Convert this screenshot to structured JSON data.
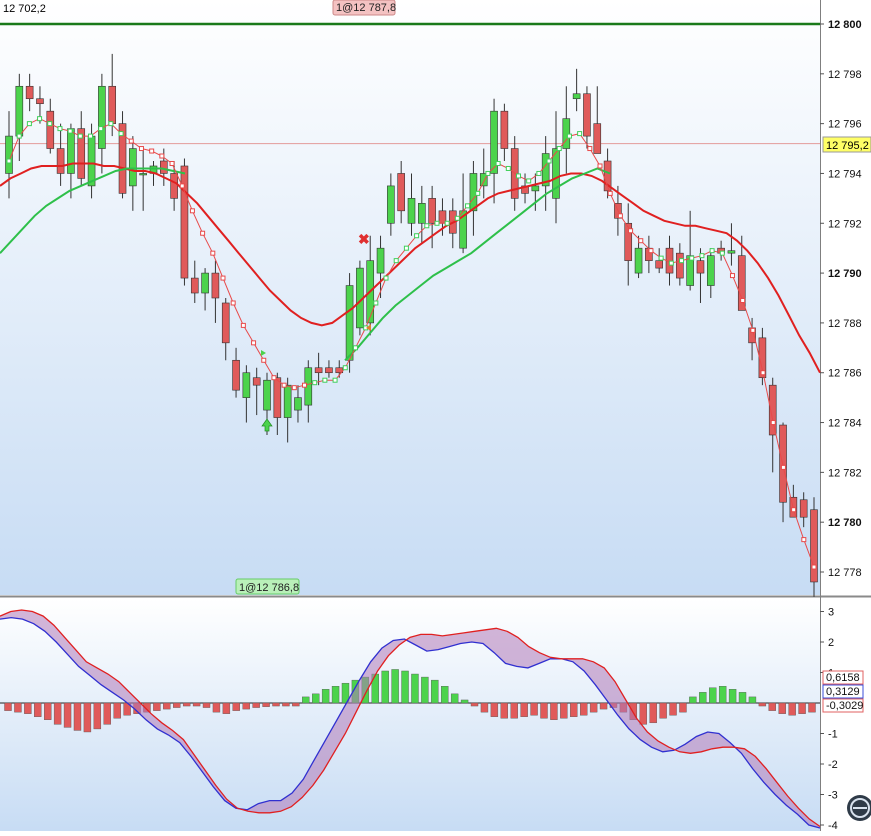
{
  "header": {
    "top_left_value": "12 702,2"
  },
  "order_labels": {
    "sell_order": "1@12 787,8",
    "buy_order": "1@12 786,8"
  },
  "price_panel": {
    "axis_ticks": [
      "12 800",
      "12 798",
      "12 796",
      "12 794",
      "12 792",
      "12 790",
      "12 788",
      "12 786",
      "12 784",
      "12 782",
      "12 780",
      "12 778"
    ],
    "axis_tick_values": [
      12800,
      12798,
      12796,
      12794,
      12792,
      12790,
      12788,
      12786,
      12784,
      12782,
      12780,
      12778
    ],
    "current_price_label": "12 795,2",
    "current_price": 12795.2,
    "resistance_level": 12800
  },
  "oscillator_panel": {
    "axis_ticks": [
      "3",
      "2",
      "1",
      "-1",
      "-2",
      "-3",
      "-4"
    ],
    "axis_tick_values": [
      3,
      2,
      1,
      -1,
      -2,
      -3,
      -4
    ],
    "value_labels": [
      {
        "text": "0,6158",
        "value": 0.6158,
        "color": "#e06060"
      },
      {
        "text": "0,3129",
        "value": 0.3129,
        "color": "#3b4fd8"
      },
      {
        "text": "-0,3029",
        "value": -0.3029,
        "color": "#e06060"
      }
    ]
  },
  "colors": {
    "up_candle": "#4cd34c",
    "down_candle": "#e05a5a",
    "slow_ma": "#e02020",
    "green_ma": "#2ec04a",
    "fast_ma_red": "#e84a4a",
    "fast_ma_green": "#3fcf5a",
    "osc_red": "#e02020",
    "osc_blue": "#3030d0",
    "hist_pos": "#4cd34c",
    "hist_neg": "#e05a5a"
  },
  "chart_data": {
    "type": "candlestick",
    "price_range": [
      12777,
      12801
    ],
    "oscillator_range": [
      -4.1,
      3.2
    ],
    "candles": [
      [
        12794.0,
        12796.5,
        12793.0,
        12795.5
      ],
      [
        12795.5,
        12798.0,
        12794.5,
        12797.5
      ],
      [
        12797.5,
        12798.0,
        12796.5,
        12797.0
      ],
      [
        12797.0,
        12797.5,
        12796.0,
        12796.8
      ],
      [
        12796.5,
        12797.0,
        12794.8,
        12795.0
      ],
      [
        12795.0,
        12796.0,
        12793.5,
        12794.0
      ],
      [
        12794.0,
        12796.0,
        12793.0,
        12795.8
      ],
      [
        12795.8,
        12796.5,
        12793.5,
        12793.8
      ],
      [
        12793.5,
        12796.0,
        12793.0,
        12795.5
      ],
      [
        12795.0,
        12798.0,
        12794.0,
        12797.5
      ],
      [
        12797.5,
        12798.8,
        12795.5,
        12796.0
      ],
      [
        12796.0,
        12796.5,
        12793.0,
        12793.2
      ],
      [
        12793.5,
        12795.5,
        12792.5,
        12795.0
      ],
      [
        12794.0,
        12795.0,
        12792.5,
        12794.0
      ],
      [
        12794.0,
        12794.5,
        12793.5,
        12794.3
      ],
      [
        12794.5,
        12795.0,
        12793.5,
        12794.0
      ],
      [
        12794.0,
        12794.5,
        12792.5,
        12793.0
      ],
      [
        12794.3,
        12794.6,
        12789.5,
        12789.8
      ],
      [
        12789.8,
        12790.5,
        12788.8,
        12789.2
      ],
      [
        12789.2,
        12790.2,
        12788.5,
        12790.0
      ],
      [
        12790.0,
        12790.5,
        12788.0,
        12789.0
      ],
      [
        12788.8,
        12789.0,
        12786.5,
        12787.2
      ],
      [
        12786.5,
        12787.0,
        12785.0,
        12785.3
      ],
      [
        12785.0,
        12786.3,
        12784.0,
        12786.0
      ],
      [
        12785.8,
        12786.2,
        12784.3,
        12785.5
      ],
      [
        12784.5,
        12786.0,
        12783.5,
        12785.7
      ],
      [
        12785.8,
        12786.0,
        12783.5,
        12784.2
      ],
      [
        12784.2,
        12785.8,
        12783.2,
        12785.5
      ],
      [
        12784.5,
        12785.5,
        12784.0,
        12785.0
      ],
      [
        12784.7,
        12786.5,
        12784.0,
        12786.2
      ],
      [
        12786.2,
        12786.8,
        12785.5,
        12786.0
      ],
      [
        12786.2,
        12786.5,
        12785.8,
        12786.0
      ],
      [
        12786.2,
        12786.5,
        12785.8,
        12786.0
      ],
      [
        12786.5,
        12790.0,
        12786.0,
        12789.5
      ],
      [
        12787.8,
        12790.5,
        12787.5,
        12790.2
      ],
      [
        12788.0,
        12791.5,
        12787.5,
        12790.5
      ],
      [
        12790.0,
        12791.5,
        12789.0,
        12791.0
      ],
      [
        12792.0,
        12794.0,
        12791.5,
        12793.5
      ],
      [
        12794.0,
        12794.5,
        12792.0,
        12792.5
      ],
      [
        12792.0,
        12794.0,
        12791.5,
        12793.0
      ],
      [
        12792.0,
        12793.5,
        12791.2,
        12792.8
      ],
      [
        12793.0,
        12793.5,
        12791.0,
        12792.0
      ],
      [
        12792.5,
        12793.0,
        12791.5,
        12792.0
      ],
      [
        12792.5,
        12793.0,
        12791.0,
        12791.6
      ],
      [
        12791.0,
        12794.0,
        12790.8,
        12792.5
      ],
      [
        12792.5,
        12794.5,
        12791.5,
        12794.0
      ],
      [
        12793.5,
        12795.0,
        12793.0,
        12794.0
      ],
      [
        12794.0,
        12797.0,
        12792.8,
        12796.5
      ],
      [
        12796.5,
        12796.8,
        12794.5,
        12795.0
      ],
      [
        12795.0,
        12795.5,
        12792.5,
        12793.0
      ],
      [
        12793.5,
        12794.0,
        12792.8,
        12793.2
      ],
      [
        12793.3,
        12794.0,
        12792.5,
        12793.5
      ],
      [
        12793.5,
        12795.5,
        12792.5,
        12794.8
      ],
      [
        12793.0,
        12796.5,
        12792.0,
        12795.0
      ],
      [
        12795.0,
        12797.5,
        12794.0,
        12796.2
      ],
      [
        12797.0,
        12798.2,
        12796.5,
        12797.2
      ],
      [
        12797.2,
        12797.5,
        12795.0,
        12795.5
      ],
      [
        12796.0,
        12797.5,
        12795.0,
        12794.8
      ],
      [
        12794.5,
        12795.0,
        12793.0,
        12793.3
      ],
      [
        12792.8,
        12793.5,
        12791.5,
        12792.2
      ],
      [
        12792.0,
        12792.8,
        12789.5,
        12790.5
      ],
      [
        12790.0,
        12791.5,
        12789.8,
        12791.0
      ],
      [
        12791.0,
        12791.5,
        12790.0,
        12790.5
      ],
      [
        12790.5,
        12791.0,
        12790.0,
        12790.2
      ],
      [
        12791.0,
        12791.5,
        12789.5,
        12790.0
      ],
      [
        12790.8,
        12791.2,
        12789.5,
        12789.8
      ],
      [
        12789.5,
        12792.5,
        12789.3,
        12790.7
      ],
      [
        12790.5,
        12791.0,
        12788.8,
        12790.0
      ],
      [
        12789.5,
        12791.0,
        12789.0,
        12790.7
      ],
      [
        12791.0,
        12791.3,
        12790.5,
        12790.8
      ],
      [
        12790.8,
        12792.0,
        12790.3,
        12790.9
      ],
      [
        12790.7,
        12791.5,
        12790.5,
        12788.5
      ],
      [
        12787.8,
        12788.2,
        12786.5,
        12787.2
      ],
      [
        12787.4,
        12787.8,
        12785.5,
        12785.8
      ],
      [
        12785.5,
        12785.8,
        12782.0,
        12783.5
      ],
      [
        12783.9,
        12784.0,
        12780.0,
        12780.8
      ],
      [
        12781.0,
        12781.5,
        12780.2,
        12780.2
      ],
      [
        12780.9,
        12781.2,
        12779.8,
        12780.2
      ],
      [
        12780.5,
        12781.0,
        12777.0,
        12777.6
      ]
    ],
    "slow_ma": [
      12793.5,
      12793.8,
      12794.0,
      12794.2,
      12794.3,
      12794.3,
      12794.3,
      12794.4,
      12794.4,
      12794.4,
      12794.3,
      12794.3,
      12794.2,
      12794.1,
      12794.1,
      12794.0,
      12793.8,
      12793.6,
      12793.2,
      12792.8,
      12792.3,
      12791.8,
      12791.3,
      12790.8,
      12790.3,
      12789.8,
      12789.3,
      12788.9,
      12788.5,
      12788.2,
      12788.0,
      12787.9,
      12788.0,
      12788.3,
      12788.6,
      12789.0,
      12789.4,
      12789.8,
      12790.2,
      12790.6,
      12791.0,
      12791.3,
      12791.6,
      12791.9,
      12792.1,
      12792.4,
      12792.7,
      12793.0,
      12793.2,
      12793.3,
      12793.4,
      12793.5,
      12793.6,
      12793.7,
      12793.9,
      12794.0,
      12794.0,
      12793.9,
      12793.7,
      12793.4,
      12793.1,
      12792.8,
      12792.5,
      12792.3,
      12792.1,
      12792.0,
      12791.9,
      12791.9,
      12791.8,
      12791.7,
      12791.6,
      12791.3,
      12790.9,
      12790.4,
      12789.8,
      12789.1,
      12788.3,
      12787.5,
      12786.8,
      12786.0
    ],
    "green_ma": [
      12790.8,
      12791.3,
      12791.8,
      12792.3,
      12792.7,
      12793.0,
      12793.3,
      12793.5,
      12793.7,
      12793.9,
      12794.1,
      12794.2,
      12794.2,
      12794.2,
      12794.2,
      12794.1,
      12794.0
    ],
    "green_ma_right": [
      12786.5,
      12787.0,
      12787.6,
      12788.2,
      12788.7,
      12789.1,
      12789.5,
      12789.9,
      12790.2,
      12790.5,
      12790.8,
      12791.2,
      12791.6,
      12792.0,
      12792.4,
      12792.8,
      12793.2,
      12793.5,
      12793.8,
      12794.0,
      12794.2,
      12794.0
    ],
    "fast_ma": [
      12794.5,
      12795.5,
      12796.0,
      12796.2,
      12796.0,
      12795.8,
      12795.7,
      12795.5,
      12795.5,
      12795.8,
      12796.0,
      12795.6,
      12795.3,
      12795.0,
      12794.9,
      12794.7,
      12794.4,
      12793.5,
      12792.5,
      12791.6,
      12790.8,
      12789.8,
      12788.8,
      12787.9,
      12787.2,
      12786.5,
      12785.8,
      12785.5,
      12785.4,
      12785.5,
      12785.6,
      12785.7,
      12785.7,
      12786.2,
      12787.0,
      12787.8,
      12788.8,
      12789.8,
      12790.5,
      12791.0,
      12791.5,
      12791.9,
      12792.0,
      12792.0,
      12792.2,
      12792.7,
      12793.2,
      12794.0,
      12794.4,
      12794.2,
      12793.9,
      12793.7,
      12794.0,
      12794.5,
      12795.0,
      12795.5,
      12795.6,
      12795.0,
      12794.3,
      12793.2,
      12792.3,
      12791.7,
      12791.3,
      12790.9,
      12790.6,
      12790.4,
      12790.5,
      12790.6,
      12790.7,
      12790.9,
      12790.8,
      12789.9,
      12788.9,
      12787.7,
      12786.0,
      12784.0,
      12782.2,
      12780.5,
      12779.3,
      12778.2
    ],
    "osc_red": [
      2.85,
      3.0,
      3.05,
      3.0,
      2.85,
      2.55,
      2.15,
      1.75,
      1.35,
      1.15,
      0.95,
      0.7,
      0.35,
      0.0,
      -0.35,
      -0.65,
      -0.9,
      -1.2,
      -1.7,
      -2.2,
      -2.7,
      -3.15,
      -3.45,
      -3.55,
      -3.6,
      -3.6,
      -3.55,
      -3.4,
      -3.1,
      -2.7,
      -2.2,
      -1.6,
      -1.0,
      -0.3,
      0.4,
      1.05,
      1.55,
      1.9,
      2.15,
      2.25,
      2.25,
      2.2,
      2.25,
      2.3,
      2.35,
      2.4,
      2.45,
      2.35,
      2.15,
      1.85,
      1.65,
      1.5,
      1.45,
      1.45,
      1.45,
      1.35,
      1.15,
      0.7,
      0.1,
      -0.5,
      -0.95,
      -1.25,
      -1.45,
      -1.6,
      -1.65,
      -1.6,
      -1.5,
      -1.45,
      -1.45,
      -1.5,
      -1.75,
      -2.15,
      -2.6,
      -3.05,
      -3.45,
      -3.8,
      -4.05
    ],
    "osc_blue": [
      2.75,
      2.8,
      2.75,
      2.6,
      2.35,
      2.0,
      1.6,
      1.2,
      0.9,
      0.6,
      0.35,
      0.1,
      -0.2,
      -0.55,
      -0.85,
      -1.05,
      -1.3,
      -1.75,
      -2.25,
      -2.75,
      -3.2,
      -3.45,
      -3.5,
      -3.3,
      -3.2,
      -3.2,
      -2.95,
      -2.5,
      -1.85,
      -1.2,
      -0.55,
      0.1,
      0.75,
      1.35,
      1.8,
      2.05,
      2.1,
      1.9,
      1.7,
      1.75,
      1.85,
      1.95,
      2.0,
      1.95,
      1.65,
      1.3,
      1.2,
      1.15,
      1.3,
      1.45,
      1.45,
      1.35,
      1.05,
      0.6,
      0.1,
      -0.4,
      -0.85,
      -1.2,
      -1.45,
      -1.6,
      -1.55,
      -1.35,
      -1.1,
      -0.95,
      -1.0,
      -1.3,
      -1.65,
      -2.15,
      -2.6,
      -3.0,
      -3.35,
      -3.65,
      -4.0,
      -4.1
    ],
    "histogram": [
      -0.25,
      -0.3,
      -0.35,
      -0.45,
      -0.55,
      -0.7,
      -0.8,
      -0.9,
      -0.95,
      -0.85,
      -0.7,
      -0.5,
      -0.4,
      -0.35,
      -0.3,
      -0.25,
      -0.2,
      -0.15,
      -0.1,
      -0.1,
      -0.15,
      -0.3,
      -0.35,
      -0.25,
      -0.2,
      -0.15,
      -0.12,
      -0.1,
      -0.1,
      -0.1,
      0.2,
      0.3,
      0.45,
      0.55,
      0.65,
      0.75,
      0.85,
      0.95,
      1.05,
      1.1,
      1.05,
      0.95,
      0.85,
      0.75,
      0.55,
      0.3,
      0.1,
      -0.1,
      -0.3,
      -0.45,
      -0.5,
      -0.5,
      -0.45,
      -0.4,
      -0.5,
      -0.55,
      -0.5,
      -0.45,
      -0.4,
      -0.3,
      -0.2,
      -0.15,
      -0.3,
      -0.55,
      -0.7,
      -0.65,
      -0.5,
      -0.4,
      -0.3,
      0.2,
      0.35,
      0.5,
      0.55,
      0.45,
      0.35,
      0.2,
      -0.1,
      -0.25,
      -0.35,
      -0.4,
      -0.35,
      -0.3
    ]
  }
}
